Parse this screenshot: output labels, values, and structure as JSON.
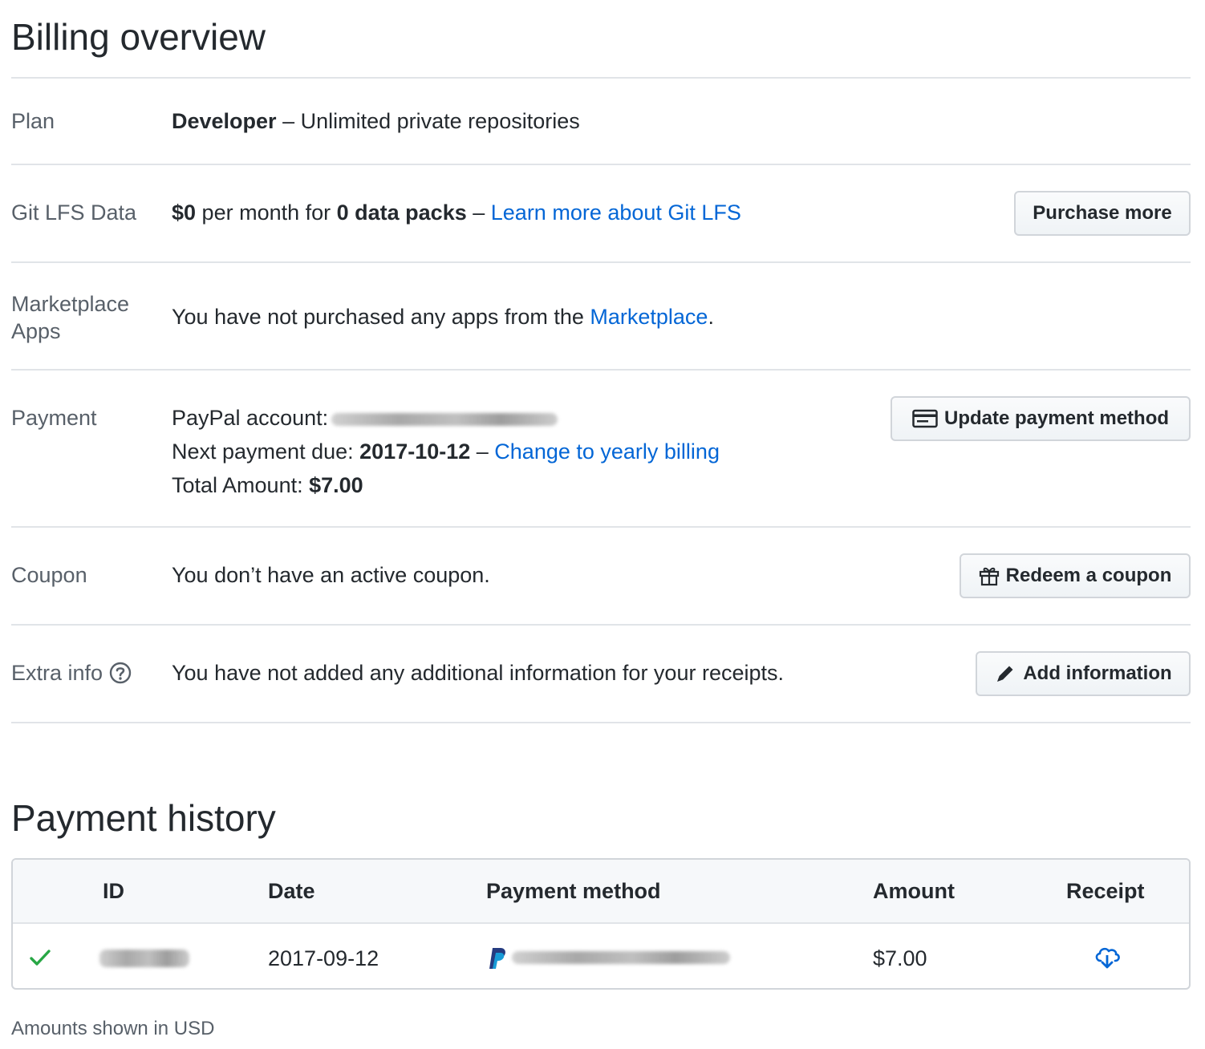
{
  "billing": {
    "title": "Billing overview",
    "plan": {
      "label": "Plan",
      "name": "Developer",
      "sep": " – ",
      "desc": "Unlimited private repositories"
    },
    "lfs": {
      "label": "Git LFS Data",
      "amount": "$0",
      "text1": " per month for ",
      "packs": "0 data packs",
      "sep": " – ",
      "link": "Learn more about Git LFS",
      "button": "Purchase more"
    },
    "marketplace": {
      "label_line1": "Marketplace",
      "label_line2": "Apps",
      "text": "You have not purchased any apps from the ",
      "link": "Marketplace",
      "end": "."
    },
    "payment": {
      "label": "Payment",
      "paypal_label": "PayPal account:",
      "next_label": "Next payment due: ",
      "next_date": "2017-10-12",
      "sep": " – ",
      "yearly_link": "Change to yearly billing",
      "total_label": "Total Amount: ",
      "total_amount": "$7.00",
      "button": "Update payment method"
    },
    "coupon": {
      "label": "Coupon",
      "text": "You don’t have an active coupon.",
      "button": "Redeem a coupon"
    },
    "extra": {
      "label": "Extra info",
      "text": "You have not added any additional information for your receipts.",
      "button": "Add information"
    }
  },
  "history": {
    "title": "Payment history",
    "columns": [
      "ID",
      "Date",
      "Payment method",
      "Amount",
      "Receipt"
    ],
    "rows": [
      {
        "status": "success",
        "date": "2017-09-12",
        "amount": "$7.00"
      }
    ],
    "footnote": "Amounts shown in USD"
  },
  "colors": {
    "link": "#0366d6",
    "success": "#28a745",
    "border": "#e1e4e8"
  }
}
